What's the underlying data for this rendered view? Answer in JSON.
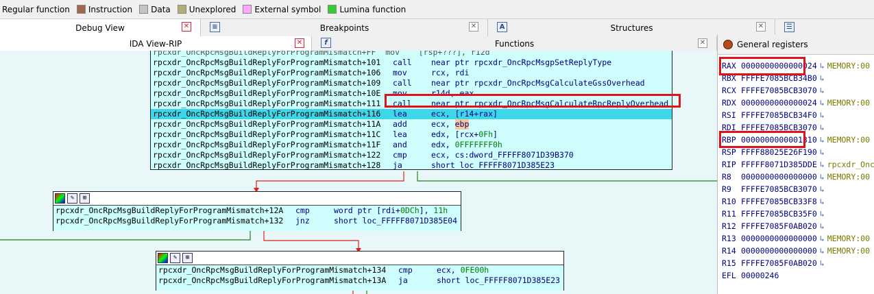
{
  "legend": [
    {
      "label": "Regular function",
      "color": "#ffffff"
    },
    {
      "label": "Instruction",
      "color": "#a0674b"
    },
    {
      "label": "Data",
      "color": "#c4c4c4"
    },
    {
      "label": "Unexplored",
      "color": "#b4ad77"
    },
    {
      "label": "External symbol",
      "color": "#ffa8ff"
    },
    {
      "label": "Lumina function",
      "color": "#33cc33"
    }
  ],
  "tabs_top": {
    "debug_view": "Debug View",
    "breakpoints": "Breakpoints",
    "structures": "Structures",
    "close": "✕"
  },
  "tabs_second": {
    "ida_view": "IDA View-RIP",
    "functions": "Functions",
    "general_registers": "General registers",
    "close": "✕"
  },
  "node1": {
    "partial_top": "rpcxdr_OncRpcMsgBuildReplyForProgramMismatch+FF  mov    [rsp+???], r12d",
    "rows": [
      {
        "addr": "rpcxdr_OncRpcMsgBuildReplyForProgramMismatch+101",
        "mn": "call",
        "op": "near ptr rpcxdr_OncRpcMsgpSetReplyType"
      },
      {
        "addr": "rpcxdr_OncRpcMsgBuildReplyForProgramMismatch+106",
        "mn": "mov",
        "op": "rcx, rdi"
      },
      {
        "addr": "rpcxdr_OncRpcMsgBuildReplyForProgramMismatch+109",
        "mn": "call",
        "op": "near ptr rpcxdr_OncRpcMsgCalculateGssOverhead"
      },
      {
        "addr": "rpcxdr_OncRpcMsgBuildReplyForProgramMismatch+10E",
        "mn": "mov",
        "op": "r14d, eax"
      },
      {
        "addr": "rpcxdr_OncRpcMsgBuildReplyForProgramMismatch+111",
        "mn": "call",
        "op": "near ptr rpcxdr_OncRpcMsgCalculateRpcReplyOverhead"
      },
      {
        "addr": "rpcxdr_OncRpcMsgBuildReplyForProgramMismatch+116",
        "mn": "lea",
        "op": "ecx, [r14+rax]"
      },
      {
        "addr": "rpcxdr_OncRpcMsgBuildReplyForProgramMismatch+11A",
        "mn": "add",
        "op": "ecx, ",
        "op2": "ebp"
      },
      {
        "addr": "rpcxdr_OncRpcMsgBuildReplyForProgramMismatch+11C",
        "mn": "lea",
        "op": "edx, [rcx+",
        "num": "0Fh",
        "op3": "]"
      },
      {
        "addr": "rpcxdr_OncRpcMsgBuildReplyForProgramMismatch+11F",
        "mn": "and",
        "op": "edx, ",
        "num": "0FFFFFFF0h"
      },
      {
        "addr": "rpcxdr_OncRpcMsgBuildReplyForProgramMismatch+122",
        "mn": "cmp",
        "op": "ecx, cs:dword_FFFFF8071D39B370"
      },
      {
        "addr": "rpcxdr_OncRpcMsgBuildReplyForProgramMismatch+128",
        "mn": "ja",
        "op": "short loc_FFFFF8071D385E23"
      }
    ]
  },
  "node2": {
    "rows": [
      {
        "addr": "rpcxdr_OncRpcMsgBuildReplyForProgramMismatch+12A",
        "mn": "cmp",
        "op": "word ptr [rdi+",
        "num": "0DCh",
        "op3": "], ",
        "num2": "11h"
      },
      {
        "addr": "rpcxdr_OncRpcMsgBuildReplyForProgramMismatch+132",
        "mn": "jnz",
        "op": "short loc_FFFFF8071D385E04"
      }
    ]
  },
  "node3": {
    "rows": [
      {
        "addr": "rpcxdr_OncRpcMsgBuildReplyForProgramMismatch+134",
        "mn": "cmp",
        "op": "ecx, ",
        "num": "0FE00h"
      },
      {
        "addr": "rpcxdr_OncRpcMsgBuildReplyForProgramMismatch+13A",
        "mn": "ja",
        "op": "short loc_FFFFF8071D385E23"
      }
    ]
  },
  "registers": [
    {
      "name": "RAX",
      "value": "0000000000000024",
      "arrow": "↳",
      "extra": "MEMORY:00"
    },
    {
      "name": "RBX",
      "value": "FFFFE7085BCB34B0",
      "arrow": "↳",
      "extra": ""
    },
    {
      "name": "RCX",
      "value": "FFFFE7085BCB3070",
      "arrow": "↳",
      "extra": ""
    },
    {
      "name": "RDX",
      "value": "0000000000000024",
      "arrow": "↳",
      "extra": "MEMORY:00"
    },
    {
      "name": "RSI",
      "value": "FFFFE7085BCB34F0",
      "arrow": "↳",
      "extra": ""
    },
    {
      "name": "RDI",
      "value": "FFFFE7085BCB3070",
      "arrow": "↳",
      "extra": ""
    },
    {
      "name": "RBP",
      "value": "0000000000001310",
      "arrow": "↳",
      "extra": "MEMORY:00"
    },
    {
      "name": "RSP",
      "value": "FFFF88025E26F190",
      "arrow": "↳",
      "extra": ""
    },
    {
      "name": "RIP",
      "value": "FFFFF8071D385DDE",
      "arrow": "↳",
      "extra": "rpcxdr_Onc"
    },
    {
      "name": "R8",
      "value": "0000000000000000",
      "arrow": "↳",
      "extra": "MEMORY:00"
    },
    {
      "name": "R9",
      "value": "FFFFE7085BCB3070",
      "arrow": "↳",
      "extra": ""
    },
    {
      "name": "R10",
      "value": "FFFFE7085BCB33F8",
      "arrow": "↳",
      "extra": ""
    },
    {
      "name": "R11",
      "value": "FFFFE7085BCB35F0",
      "arrow": "↳",
      "extra": ""
    },
    {
      "name": "R12",
      "value": "FFFFE7085F0AB020",
      "arrow": "↳",
      "extra": ""
    },
    {
      "name": "R13",
      "value": "0000000000000000",
      "arrow": "↳",
      "extra": "MEMORY:00"
    },
    {
      "name": "R14",
      "value": "0000000000000000",
      "arrow": "↳",
      "extra": "MEMORY:00"
    },
    {
      "name": "R15",
      "value": "FFFFE7085F0AB020",
      "arrow": "↳",
      "extra": ""
    },
    {
      "name": "EFL",
      "value": "00000246",
      "arrow": "",
      "extra": ""
    }
  ]
}
